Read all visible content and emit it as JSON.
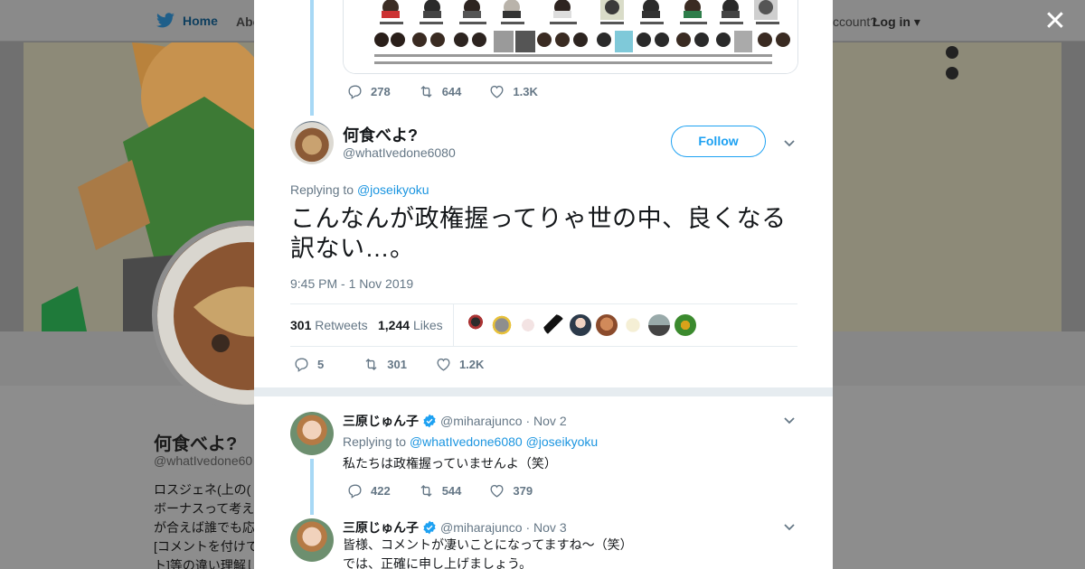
{
  "nav": {
    "home_label": "Home",
    "about_label": "Abo",
    "account_prompt": "ccount?",
    "login_label": "Log in"
  },
  "profile": {
    "name": "何食べよ?",
    "handle": "@whatIvedone60",
    "bio_lines": [
      "ロスジェネ(上の(",
      "ボーナスって考え",
      "が合えば誰でも応",
      "[コメントを付けて",
      "ト]等の違い理解し"
    ]
  },
  "modal": {
    "previous_tweet": {
      "actions": {
        "replies": "278",
        "retweets": "644",
        "likes": "1.3K"
      }
    },
    "main_tweet": {
      "author_name": "何食べよ?",
      "author_handle": "@whatIvedone6080",
      "follow_label": "Follow",
      "replying_prefix": "Replying to",
      "replying_mention": "@joseikyoku",
      "text": "こんなんが政権握ってりゃ世の中、良くなる訳ない…。",
      "timestamp": "9:45 PM - 1 Nov 2019",
      "retweets_count": "301",
      "retweets_label": "Retweets",
      "likes_count": "1,244",
      "likes_label": "Likes",
      "actions": {
        "replies": "5",
        "retweets": "301",
        "likes": "1.2K"
      }
    },
    "replies": [
      {
        "name": "三原じゅん子",
        "handle": "@miharajunco",
        "date": "· Nov 2",
        "replying_prefix": "Replying to",
        "mention1": "@whatIvedone6080",
        "mention2": "@joseikyoku",
        "text": "私たちは政権握っていませんよ（笑）",
        "actions": {
          "replies": "422",
          "retweets": "544",
          "likes": "379"
        }
      },
      {
        "name": "三原じゅん子",
        "handle": "@miharajunco",
        "date": "· Nov 3",
        "text_line1": "皆様、コメントが凄いことになってますね〜（笑）",
        "text_line2": "では、正確に申し上げましょう。"
      }
    ]
  },
  "colors": {
    "accent": "#1da1f2",
    "link": "#1b95e0",
    "muted_text": "#657786",
    "thread_line": "#a7d8f5"
  },
  "icons": [
    "twitter-bird-icon",
    "close-icon",
    "reply-icon",
    "retweet-icon",
    "like-icon",
    "chevron-down-icon",
    "verified-badge-icon"
  ]
}
